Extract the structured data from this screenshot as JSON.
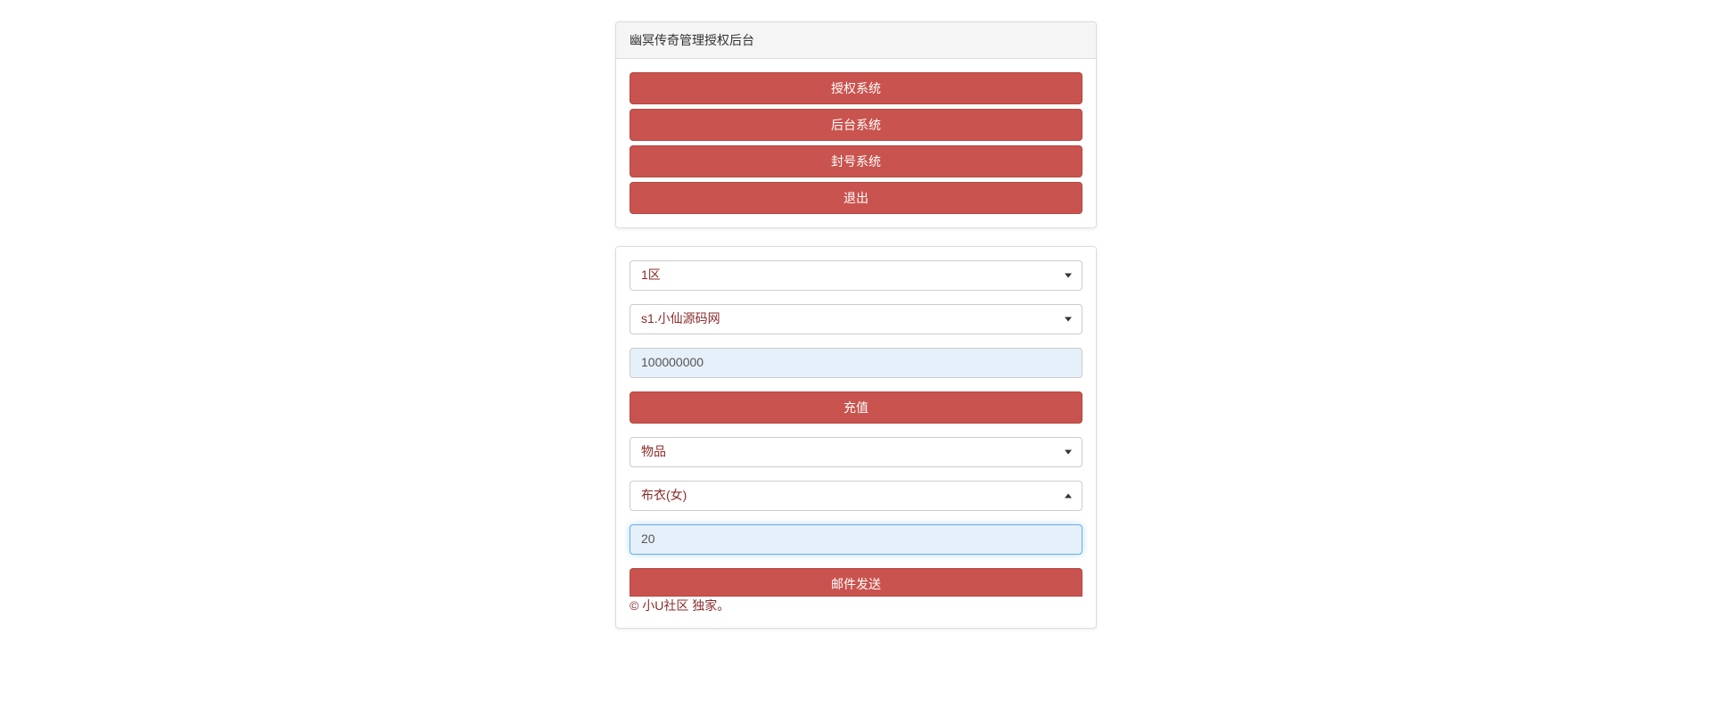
{
  "header": {
    "title": "幽冥传奇管理授权后台"
  },
  "nav": {
    "authorize": "授权系统",
    "backend": "后台系统",
    "ban": "封号系统",
    "logout": "退出"
  },
  "recharge": {
    "zone_select": "1区",
    "server_select": "s1.小仙源码网",
    "amount_value": "100000000",
    "recharge_btn": "充值"
  },
  "mail": {
    "type_select": "物品",
    "item_select": "布衣(女)",
    "qty_value": "20",
    "send_btn": "邮件发送"
  },
  "footer": {
    "text": "© 小U社区 独家。"
  }
}
